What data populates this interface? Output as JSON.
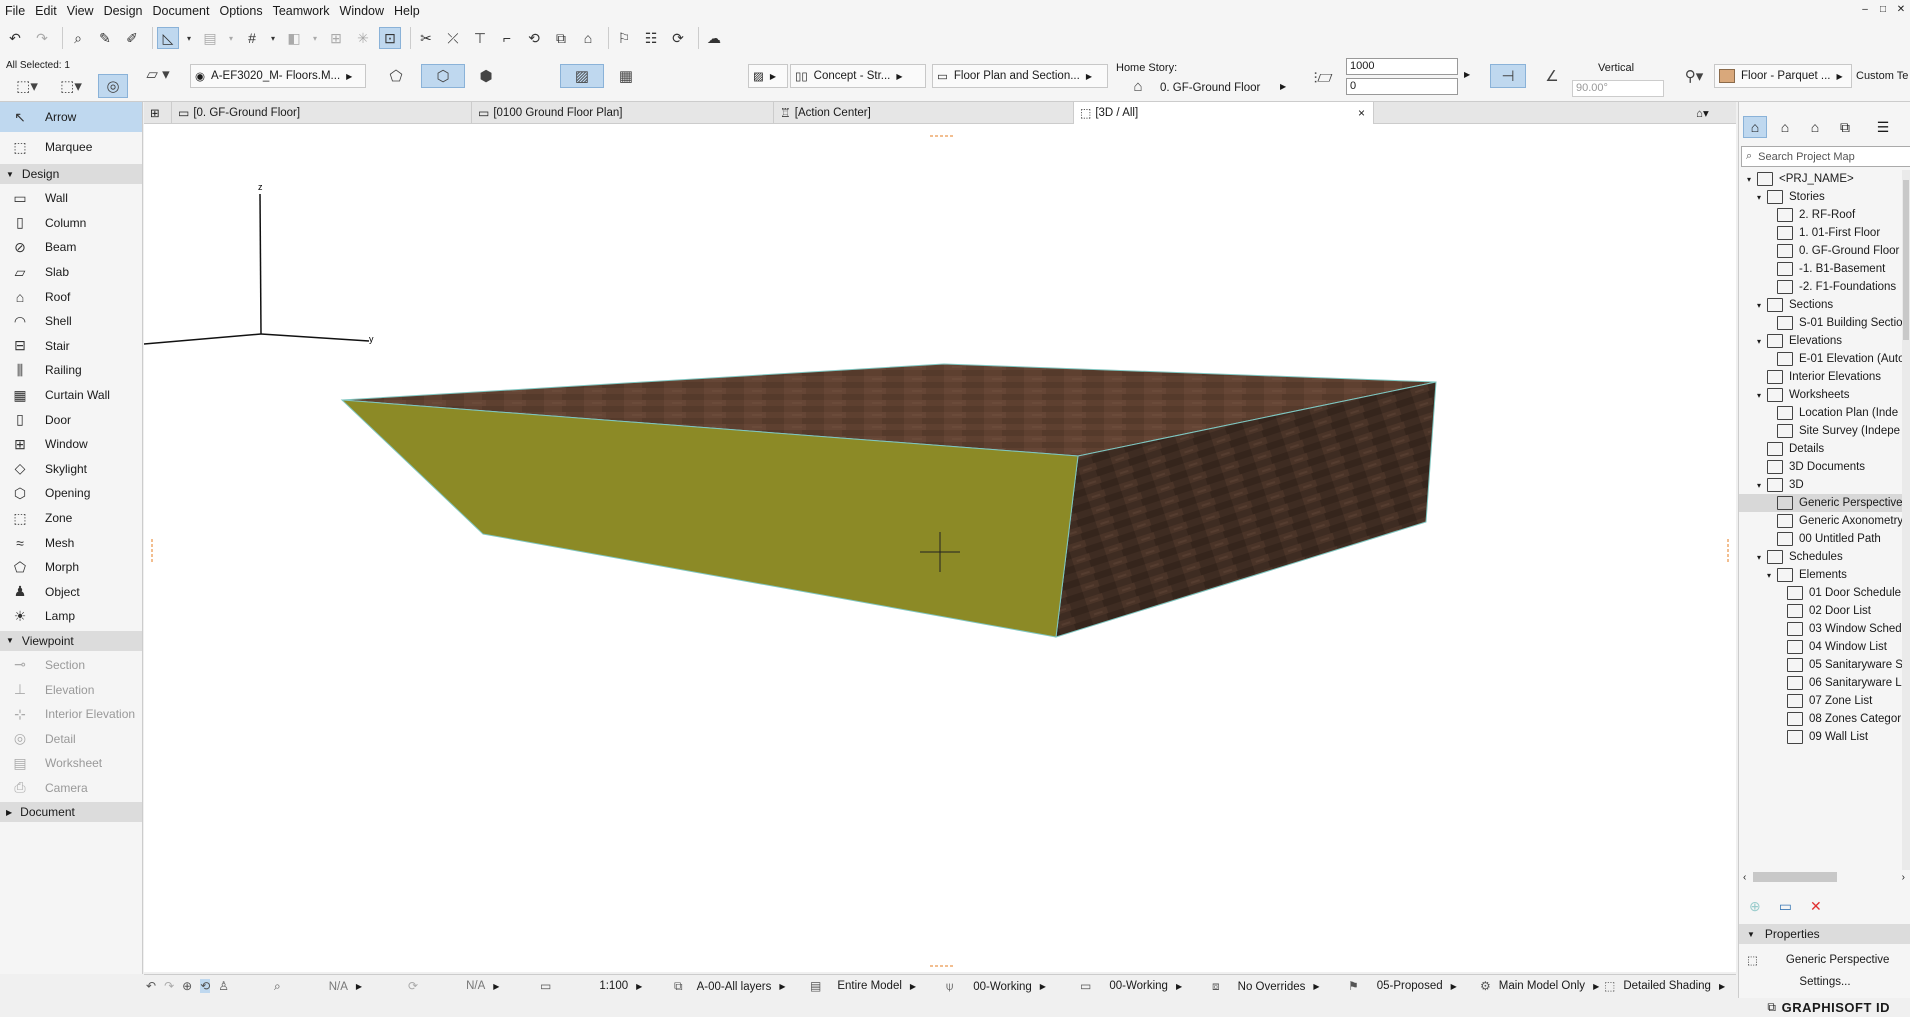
{
  "menu": [
    "File",
    "Edit",
    "View",
    "Design",
    "Document",
    "Options",
    "Teamwork",
    "Window",
    "Help"
  ],
  "window_controls": {
    "minimize": "–",
    "maximize": "□",
    "close": "✕"
  },
  "infobox": {
    "all_selected": "All Selected: 1",
    "layer": "A-EF3020_M- Floors.M...",
    "structure": "Concept - Str...",
    "floor_plan_section": "Floor Plan and Section...",
    "home_story_label": "Home Story:",
    "home_story": "0. GF-Ground Floor",
    "thickness": "1000",
    "offset": "0",
    "vertical_label": "Vertical",
    "angle": "90.00°",
    "surface": "Floor - Parquet ...",
    "custom": "Custom Te"
  },
  "toolbox": {
    "arrow": "Arrow",
    "marquee": "Marquee",
    "design_header": "Design",
    "design_tools": [
      "Wall",
      "Column",
      "Beam",
      "Slab",
      "Roof",
      "Shell",
      "Stair",
      "Railing",
      "Curtain Wall",
      "Door",
      "Window",
      "Skylight",
      "Opening",
      "Zone",
      "Mesh",
      "Morph",
      "Object",
      "Lamp"
    ],
    "viewpoint_header": "Viewpoint",
    "viewpoint_tools": [
      "Section",
      "Elevation",
      "Interior Elevation",
      "Detail",
      "Worksheet",
      "Camera"
    ],
    "document_header": "Document"
  },
  "tabs": [
    "[0. GF-Ground Floor]",
    "[0100 Ground Floor Plan]",
    "[Action Center]",
    "[3D / All]"
  ],
  "tab_close": "×",
  "view3d": {
    "axis_z": "z",
    "axis_y": "y",
    "top_color": "#5e4030",
    "side_color": "#8c8a26"
  },
  "statusbar": {
    "na1": "N/A",
    "na2": "N/A",
    "scale": "1:100",
    "layers": "A-00-All layers",
    "model": "Entire Model",
    "pen1": "00-Working",
    "pen2": "00-Working",
    "overrides": "No Overrides",
    "renovation": "05-Proposed",
    "main_model": "Main Model Only",
    "shading": "Detailed Shading"
  },
  "navigator": {
    "search_placeholder": "Search Project Map",
    "tree": [
      {
        "label": "<PRJ_NAME>",
        "depth": 0,
        "tw": "▾"
      },
      {
        "label": "Stories",
        "depth": 1,
        "tw": "▾"
      },
      {
        "label": "2. RF-Roof",
        "depth": 2,
        "tw": ""
      },
      {
        "label": "1. 01-First Floor",
        "depth": 2,
        "tw": ""
      },
      {
        "label": "0. GF-Ground Floor",
        "depth": 2,
        "tw": ""
      },
      {
        "label": "-1. B1-Basement",
        "depth": 2,
        "tw": ""
      },
      {
        "label": "-2. F1-Foundations",
        "depth": 2,
        "tw": ""
      },
      {
        "label": "Sections",
        "depth": 1,
        "tw": "▾"
      },
      {
        "label": "S-01 Building Sectio",
        "depth": 2,
        "tw": ""
      },
      {
        "label": "Elevations",
        "depth": 1,
        "tw": "▾"
      },
      {
        "label": "E-01 Elevation (Auto",
        "depth": 2,
        "tw": ""
      },
      {
        "label": "Interior Elevations",
        "depth": 1,
        "tw": ""
      },
      {
        "label": "Worksheets",
        "depth": 1,
        "tw": "▾"
      },
      {
        "label": "Location Plan (Inde",
        "depth": 2,
        "tw": ""
      },
      {
        "label": "Site Survey (Indepe",
        "depth": 2,
        "tw": ""
      },
      {
        "label": "Details",
        "depth": 1,
        "tw": ""
      },
      {
        "label": "3D Documents",
        "depth": 1,
        "tw": ""
      },
      {
        "label": "3D",
        "depth": 1,
        "tw": "▾"
      },
      {
        "label": "Generic Perspective",
        "depth": 2,
        "tw": "",
        "sel": true
      },
      {
        "label": "Generic Axonometry",
        "depth": 2,
        "tw": ""
      },
      {
        "label": "00 Untitled Path",
        "depth": 2,
        "tw": ""
      },
      {
        "label": "Schedules",
        "depth": 1,
        "tw": "▾"
      },
      {
        "label": "Elements",
        "depth": 2,
        "tw": "▾"
      },
      {
        "label": "01 Door Schedule",
        "depth": 3,
        "tw": ""
      },
      {
        "label": "02 Door List",
        "depth": 3,
        "tw": ""
      },
      {
        "label": "03 Window Sched",
        "depth": 3,
        "tw": ""
      },
      {
        "label": "04 Window List",
        "depth": 3,
        "tw": ""
      },
      {
        "label": "05 Sanitaryware S",
        "depth": 3,
        "tw": ""
      },
      {
        "label": "06 Sanitaryware L",
        "depth": 3,
        "tw": ""
      },
      {
        "label": "07 Zone List",
        "depth": 3,
        "tw": ""
      },
      {
        "label": "08 Zones Categor",
        "depth": 3,
        "tw": ""
      },
      {
        "label": "09 Wall List",
        "depth": 3,
        "tw": ""
      }
    ],
    "properties_header": "Properties",
    "properties_value": "Generic Perspective",
    "settings_button": "Settings..."
  },
  "brand": "GRAPHISOFT ID"
}
